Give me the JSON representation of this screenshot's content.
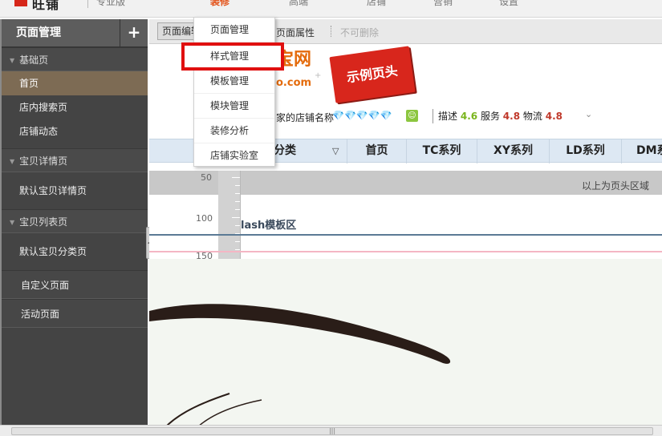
{
  "topbar": {
    "logo_text": "旺铺",
    "edition": "专业版",
    "tabs": [
      {
        "label": "装修",
        "active": true
      },
      {
        "label": "高端",
        "active": false
      },
      {
        "label": "店铺",
        "active": false
      },
      {
        "label": "营销",
        "active": false
      },
      {
        "label": "设置",
        "active": false
      }
    ]
  },
  "sidebar": {
    "title": "页面管理",
    "add_icon": "plus-icon",
    "groups": [
      {
        "label": "基础页",
        "items": [
          "首页",
          "店内搜索页",
          "店铺动态"
        ]
      },
      {
        "label": "宝贝详情页",
        "items": [
          "默认宝贝详情页"
        ]
      },
      {
        "label": "宝贝列表页",
        "items": [
          "默认宝贝分类页"
        ]
      }
    ],
    "singles": [
      "自定义页面",
      "活动页面"
    ],
    "active_item": "首页"
  },
  "toolbar": {
    "edit_button": "页面编辑",
    "props_link": "页面属性",
    "disabled_label": "不可删除"
  },
  "dropdown": {
    "items": [
      "页面管理",
      "样式管理",
      "模板管理",
      "模块管理",
      "装修分析",
      "店铺实验室"
    ],
    "highlighted": "样式管理"
  },
  "canvas": {
    "brand_line1": "宝网",
    "brand_line2": "o.com",
    "ribbon_text": "示例页头",
    "shop_label": "家的店铺名称",
    "diamonds": "💎💎💎💎💎",
    "ratings": {
      "desc_label": "描述",
      "desc_value": "4.6",
      "service_label": "服务",
      "service_value": "4.8",
      "logistics_label": "物流",
      "logistics_value": "4.8"
    },
    "nav_first": "分类",
    "nav_items": [
      "首页",
      "TC系列",
      "XY系列",
      "LD系列",
      "DM系"
    ],
    "header_label": "以上为页头区域",
    "ruler_labels": [
      "50",
      "100",
      "150"
    ],
    "flash_label": "lash模板区"
  },
  "colors": {
    "sidebar_bg": "#444444",
    "active_item": "#7d6b54",
    "accent_red": "#e01010",
    "tab_active": "#e3541c"
  }
}
